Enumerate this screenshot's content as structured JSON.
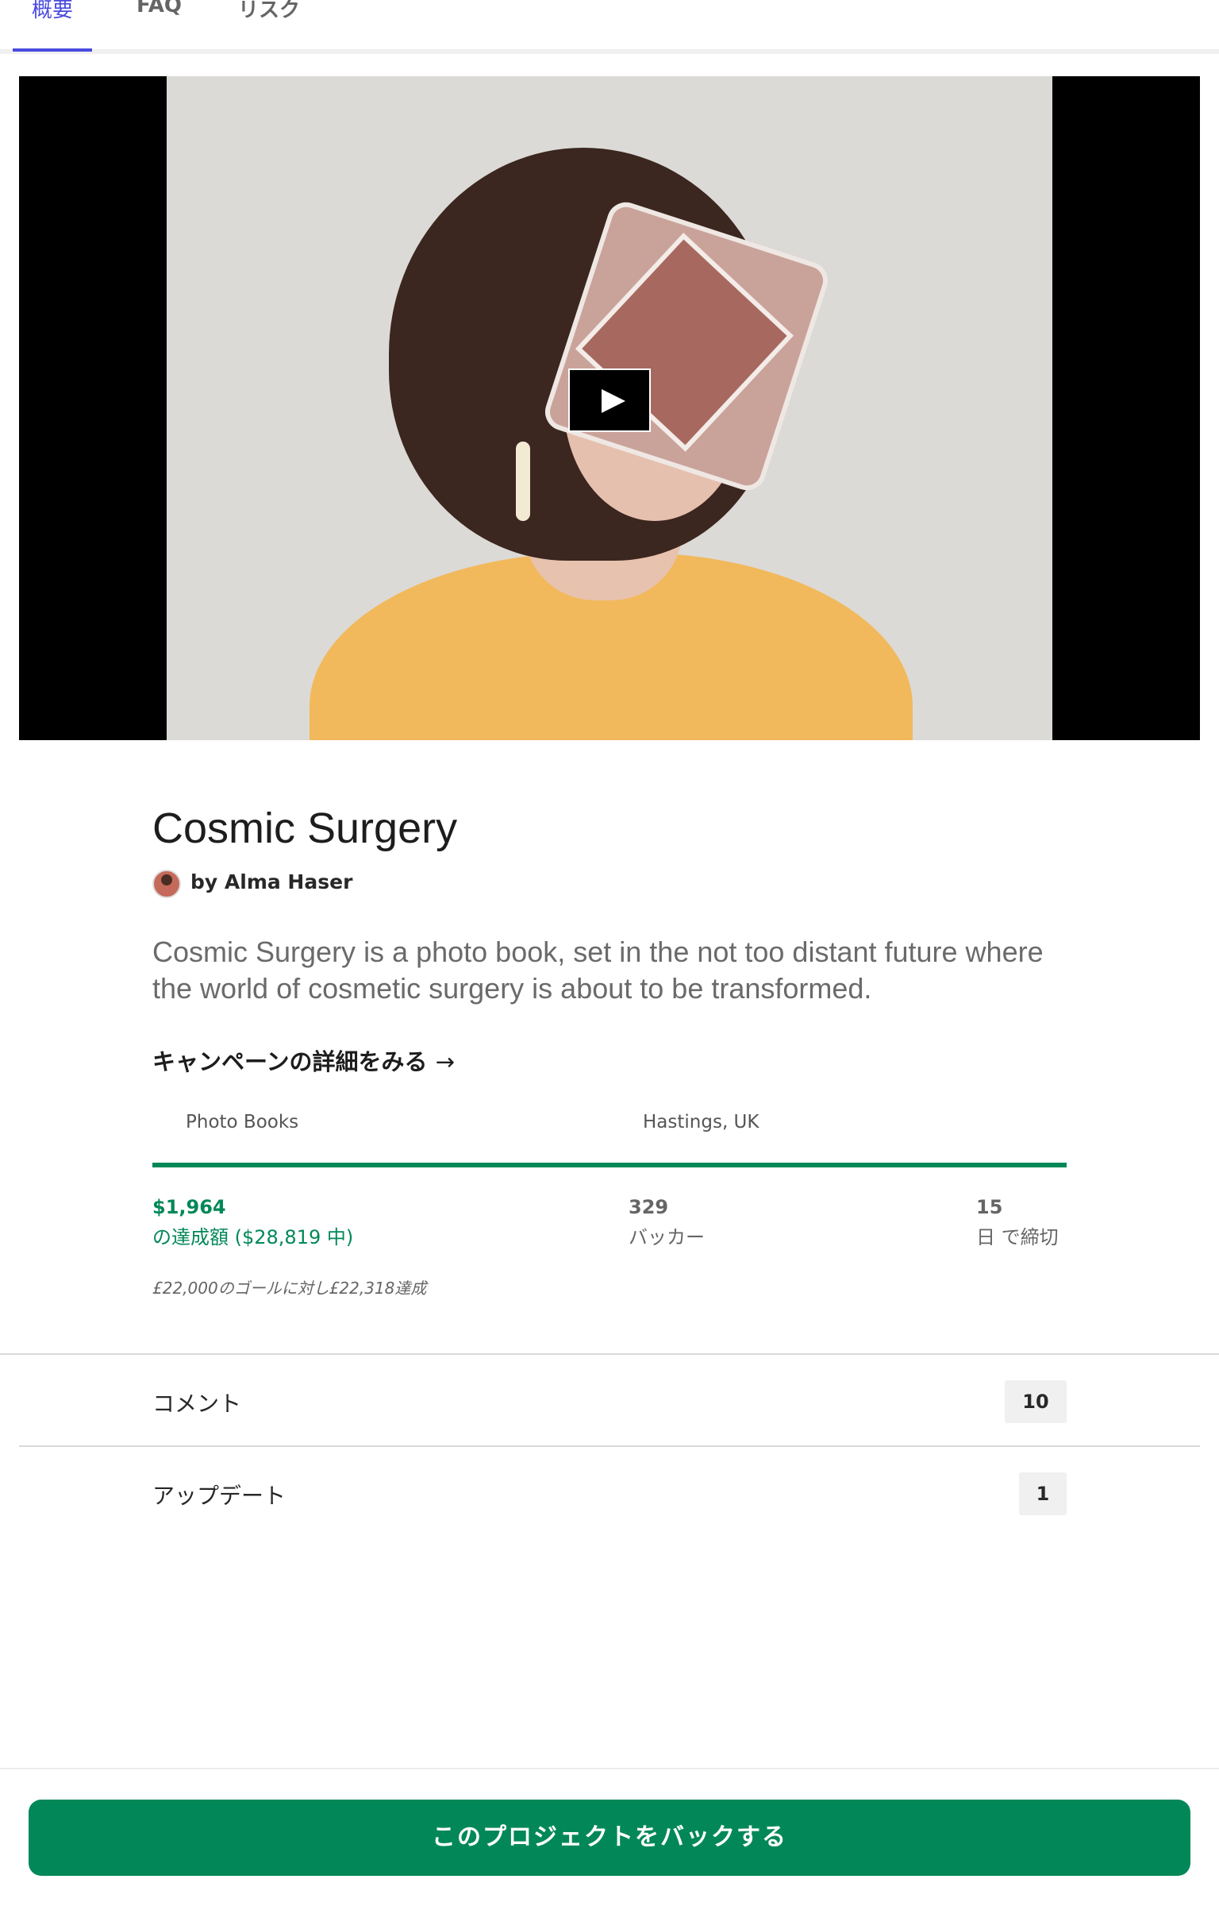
{
  "tabs": [
    {
      "label": "概要",
      "active": true
    },
    {
      "label": "FAQ",
      "active": false
    },
    {
      "label": "リスク",
      "active": false
    }
  ],
  "project": {
    "title": "Cosmic Surgery",
    "byline": "by Alma Haser",
    "blurb": "Cosmic Surgery is a photo book, set in the not too distant future where the world of cosmetic surgery is about to be transformed.",
    "details_link": "キャンペーンの詳細をみる",
    "details_arrow": "→",
    "category": "Photo Books",
    "location": "Hastings, UK"
  },
  "funding": {
    "progress_fraction": 1.0,
    "pledged_value": "$1,964",
    "pledged_label": "の達成額 ($28,819 中)",
    "backers_value": "329",
    "backers_label": "バッカー",
    "days_value": "15",
    "days_label": "日 で締切",
    "goal_note": "£22,000のゴールに対し£22,318達成"
  },
  "sections": [
    {
      "label": "コメント",
      "count": "10"
    },
    {
      "label": "アップデート",
      "count": "1"
    }
  ],
  "cta": {
    "label": "このプロジェクトをバックする"
  },
  "icons": {
    "play": "play-icon",
    "arrow": "arrow-right-icon"
  },
  "colors": {
    "accent": "#028858",
    "tab_active": "#4a4ae0"
  }
}
